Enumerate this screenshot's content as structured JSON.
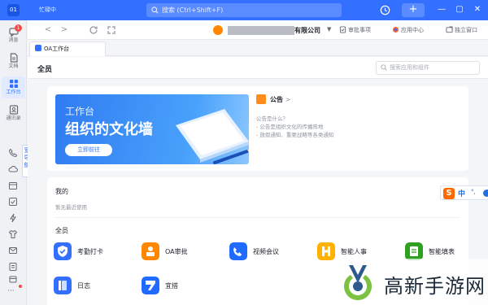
{
  "titlebar": {
    "avatar_text": "01",
    "status": "忙碌中",
    "search_placeholder": "搜索 (Ctrl+Shift+F)",
    "plus_label": "+",
    "window_controls": [
      "minimize-icon",
      "maximize-icon",
      "close-icon"
    ]
  },
  "sidebar": {
    "items": [
      {
        "label": "消息",
        "icon": "message-icon",
        "badge": "1"
      },
      {
        "label": "文档",
        "icon": "document-icon"
      },
      {
        "label": "工作台",
        "icon": "workbench-icon",
        "active": true
      },
      {
        "label": "通讯录",
        "icon": "contacts-icon"
      }
    ],
    "more_label": "···",
    "pinned_label": "宽导航"
  },
  "toolbar": {
    "org_name_visible": "有限公司",
    "links": [
      "审批事项",
      "应用中心",
      "独立窗口"
    ]
  },
  "tab": {
    "label": "OA工作台"
  },
  "main": {
    "title": "全员",
    "search_placeholder": "搜索应用和组件",
    "banner": {
      "title_small": "工作台",
      "title_large": "组织的文化墙",
      "button": "立即前往"
    },
    "notice": {
      "title": "公告",
      "arrow": ">",
      "lines": [
        "公告是什么？",
        "- 公告是组织文化的传播阵地",
        "- 放假通知、重要战略等各类通知"
      ]
    },
    "mine": {
      "label": "我的",
      "empty": "暂无最近使用"
    },
    "all": {
      "label": "全员",
      "apps": [
        {
          "name": "考勤打卡",
          "icon": "attendance-icon",
          "color": "#3370ff"
        },
        {
          "name": "OA审批",
          "icon": "approval-icon",
          "color": "#ff8800"
        },
        {
          "name": "视频会议",
          "icon": "video-meeting-icon",
          "color": "#1f6bff"
        },
        {
          "name": "智能人事",
          "icon": "hr-icon",
          "color": "#ffb300"
        },
        {
          "name": "智能填表",
          "icon": "form-icon",
          "color": "#2ea121"
        },
        {
          "name": "日志",
          "icon": "log-icon",
          "color": "#3370ff"
        },
        {
          "name": "宜搭",
          "icon": "yida-icon",
          "color": "#1f6bff"
        }
      ]
    }
  },
  "ime": {
    "logo": "S",
    "mode": "中",
    "dots": "°,"
  },
  "watermark": {
    "text": "高新手游网"
  }
}
